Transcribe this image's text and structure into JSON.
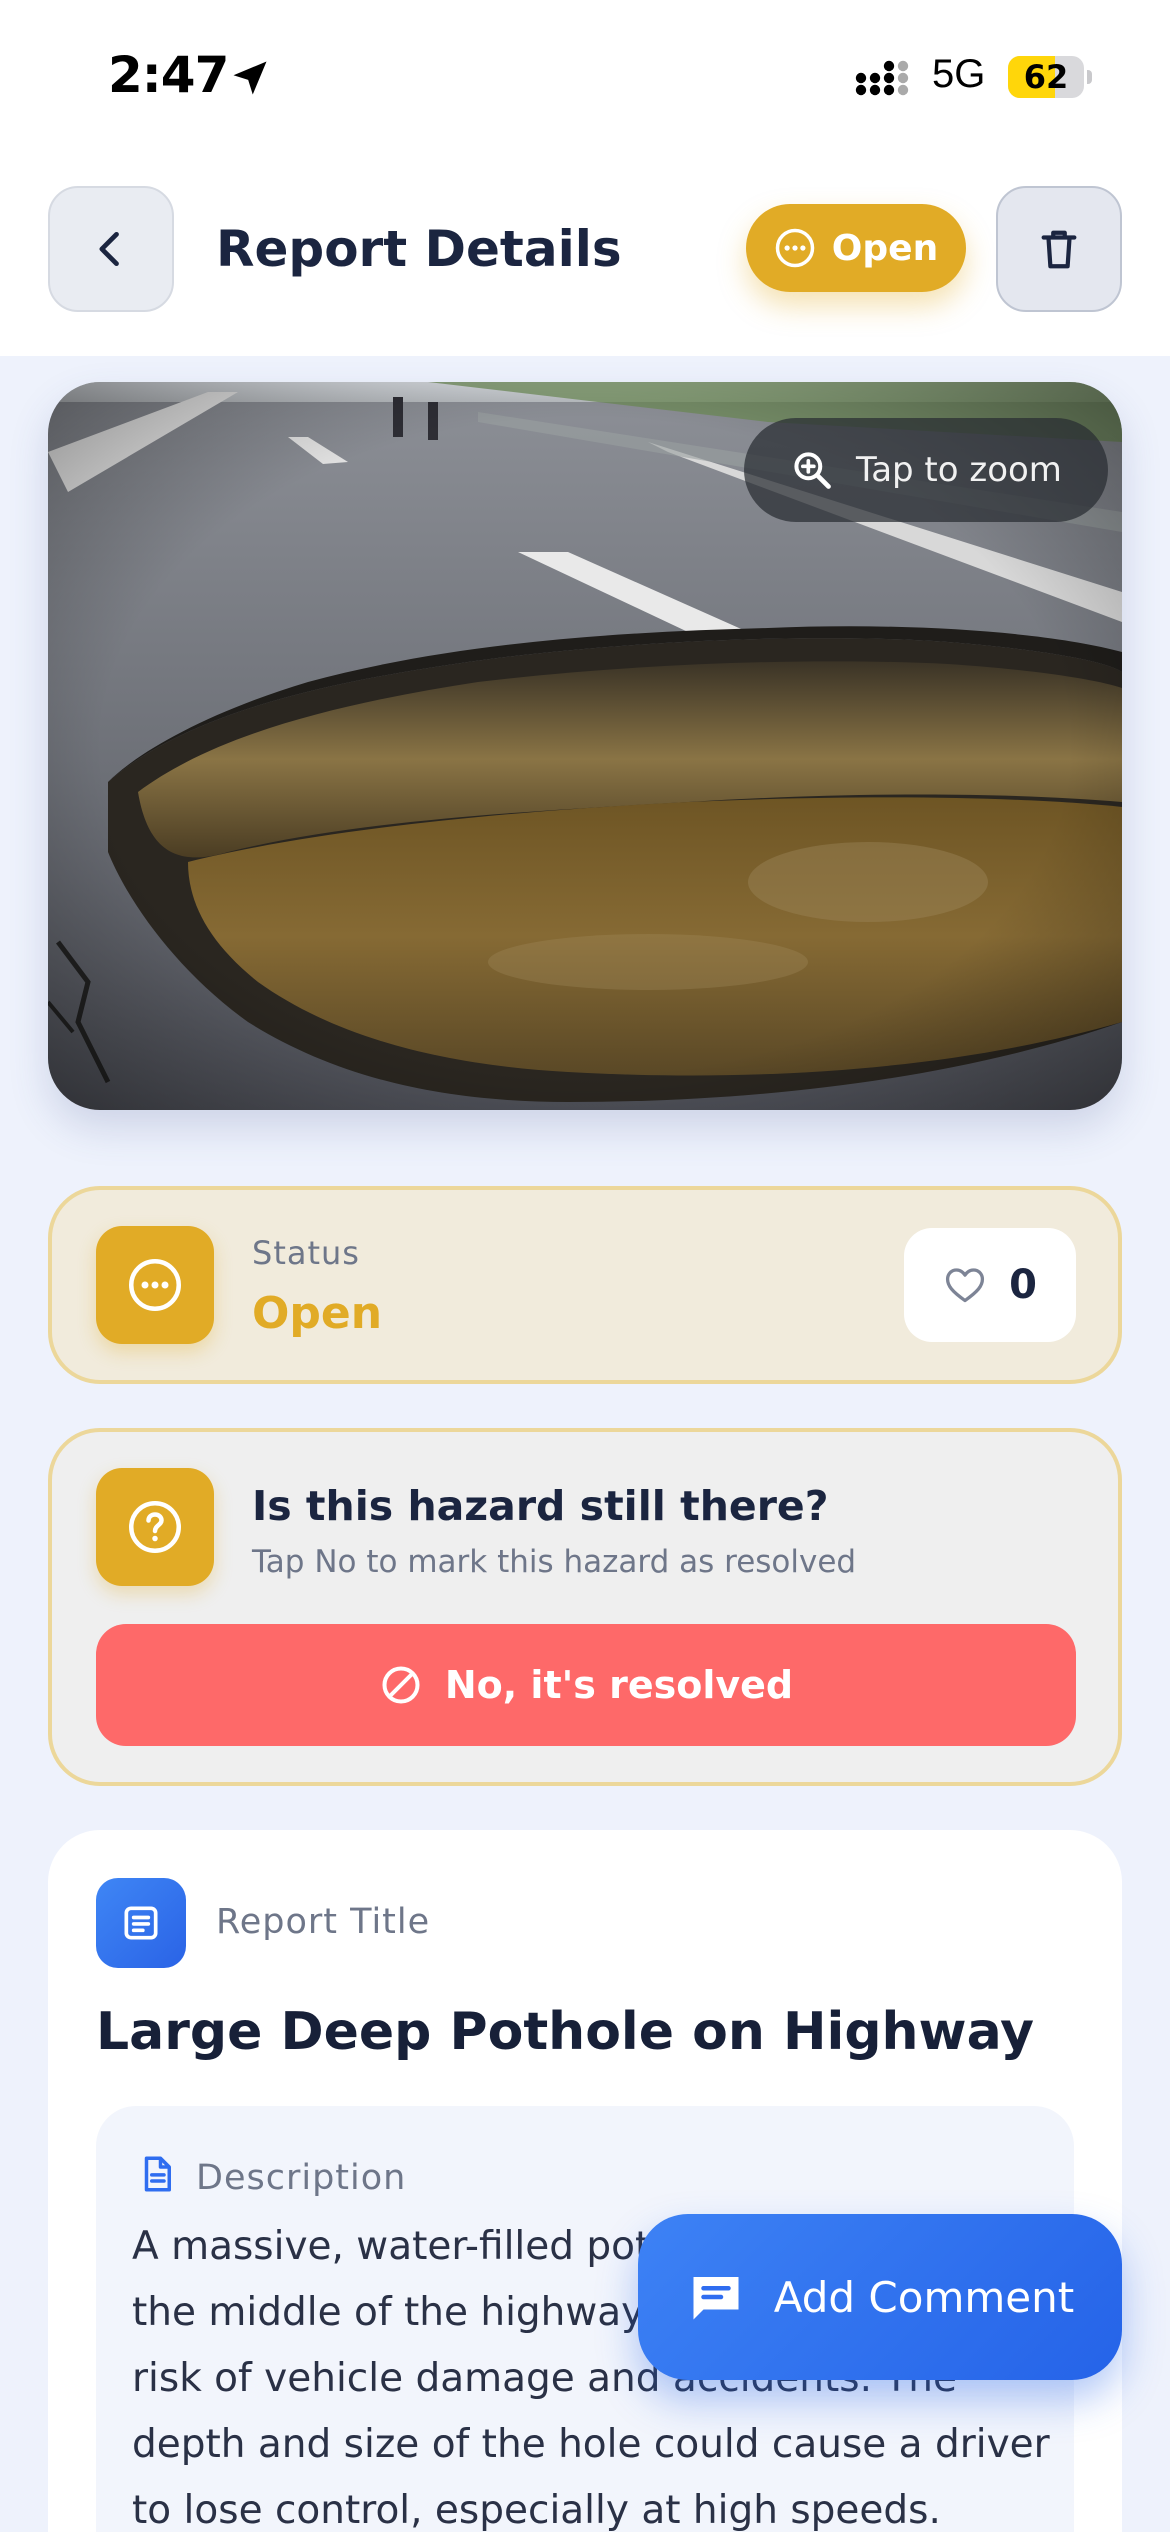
{
  "status_bar": {
    "time": "2:47",
    "network": "5G",
    "battery": "62",
    "battery_level": 0.62,
    "location_icon": "location-arrow-icon",
    "signal_icon": "cellular-signal-icon"
  },
  "header": {
    "title": "Report Details",
    "status_pill": "Open",
    "back_icon": "chevron-left-icon",
    "delete_icon": "trash-icon"
  },
  "photo": {
    "zoom_hint": "Tap to zoom",
    "zoom_icon": "zoom-in-icon"
  },
  "status_card": {
    "label": "Status",
    "value": "Open",
    "likes": "0",
    "like_icon": "heart-icon"
  },
  "hazard_card": {
    "question": "Is this hazard still there?",
    "hint": "Tap No to mark this hazard as resolved",
    "resolve_button": "No, it's resolved",
    "resolve_icon": "block-icon"
  },
  "report": {
    "title_label": "Report Title",
    "title": "Large Deep Pothole on Highway",
    "description_label": "Description",
    "description": "A massive, water-filled pothole has formed in the middle of the highway, posing a serious risk of vehicle damage and accidents. The depth and size of the hole could cause a driver to lose control, especially at high speeds."
  },
  "fab": {
    "label": "Add Comment",
    "icon": "comment-icon"
  },
  "colors": {
    "accent_open": "#e1ab26",
    "danger": "#fe6969",
    "primary": "#2f6df0",
    "background": "#eef2fc"
  }
}
